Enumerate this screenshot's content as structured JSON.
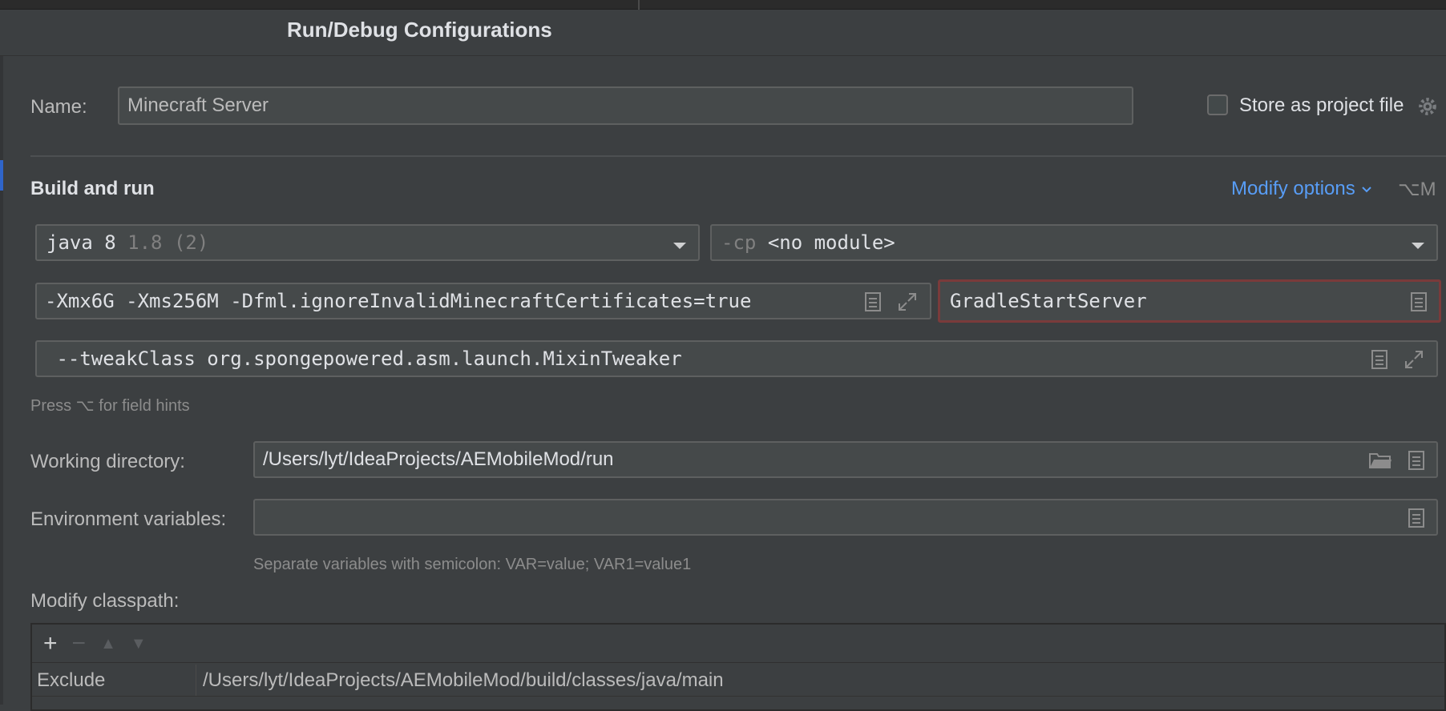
{
  "window": {
    "title": "Run/Debug Configurations"
  },
  "name_row": {
    "label": "Name:",
    "value": "Minecraft Server",
    "store_label": "Store as project file",
    "store_checked": false
  },
  "build": {
    "section_title": "Build and run",
    "modify_options": "Modify options",
    "modify_shortcut": "⌥M",
    "jre": {
      "name": "java 8",
      "version": "1.8 (2)"
    },
    "module": {
      "prefix": "-cp",
      "value": "<no module>"
    },
    "vm_options": "-Xmx6G -Xms256M -Dfml.ignoreInvalidMinecraftCertificates=true",
    "main_class": "GradleStartServer",
    "program_args": " --tweakClass org.spongepowered.asm.launch.MixinTweaker",
    "hint": "Press ⌥ for field hints"
  },
  "working_dir": {
    "label": "Working directory:",
    "value": "/Users/lyt/IdeaProjects/AEMobileMod/run"
  },
  "env": {
    "label": "Environment variables:",
    "value": "",
    "hint": "Separate variables with semicolon: VAR=value; VAR1=value1"
  },
  "classpath": {
    "label": "Modify classpath:",
    "toolbar": {
      "add": "+",
      "remove": "−",
      "up": "▲",
      "down": "▼"
    },
    "rows": [
      {
        "type": "Exclude",
        "path": "/Users/lyt/IdeaProjects/AEMobileMod/build/classes/java/main"
      }
    ]
  },
  "colors": {
    "accent": "#589df6",
    "error_border": "#7a3b3b",
    "background": "#3c3f41"
  }
}
